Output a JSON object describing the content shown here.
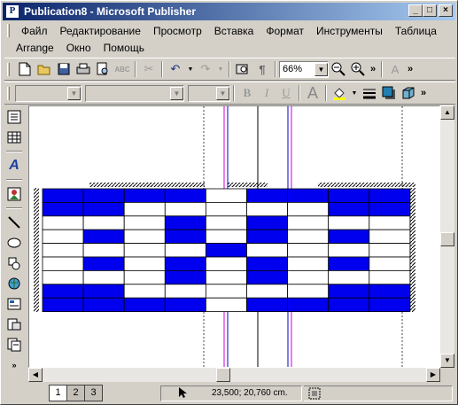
{
  "window": {
    "title": "Publication8 - Microsoft Publisher",
    "app_icon": "P"
  },
  "menu": {
    "row1": [
      "Файл",
      "Редактирование",
      "Просмотр",
      "Вставка",
      "Формат",
      "Инструменты",
      "Таблица"
    ],
    "row2": [
      "Arrange",
      "Окно",
      "Помощь"
    ]
  },
  "toolbar": {
    "zoom_value": "66%",
    "icons": [
      "new-icon",
      "open-icon",
      "save-icon",
      "print-icon",
      "print-preview-icon",
      "spelling-icon",
      "cut-icon",
      "undo-icon",
      "redo-icon",
      "find-icon",
      "special-characters-icon",
      "zoom-out-icon",
      "zoom-in-icon",
      "more-icon"
    ]
  },
  "format_toolbar": {
    "style_value": "",
    "font_value": "",
    "size_value": "",
    "bold": "B",
    "italic": "I",
    "underline": "U",
    "font_size_icon": "A"
  },
  "table": {
    "cols": 9,
    "rows": 9,
    "blue_color": "#0000ee",
    "pattern": [
      [
        1,
        1,
        1,
        1,
        0,
        1,
        1,
        1,
        1
      ],
      [
        1,
        1,
        0,
        0,
        0,
        0,
        0,
        1,
        1
      ],
      [
        0,
        0,
        0,
        1,
        0,
        1,
        0,
        0,
        0
      ],
      [
        0,
        1,
        0,
        1,
        0,
        1,
        0,
        1,
        0
      ],
      [
        0,
        0,
        0,
        0,
        1,
        0,
        0,
        0,
        0
      ],
      [
        0,
        1,
        0,
        1,
        0,
        1,
        0,
        1,
        0
      ],
      [
        0,
        0,
        0,
        1,
        0,
        1,
        0,
        0,
        0
      ],
      [
        1,
        1,
        0,
        0,
        0,
        0,
        0,
        1,
        1
      ],
      [
        1,
        1,
        1,
        1,
        0,
        1,
        1,
        1,
        1
      ]
    ]
  },
  "pages": [
    "1",
    "2",
    "3"
  ],
  "status": {
    "coordinates": "23,500; 20,760 cm."
  }
}
